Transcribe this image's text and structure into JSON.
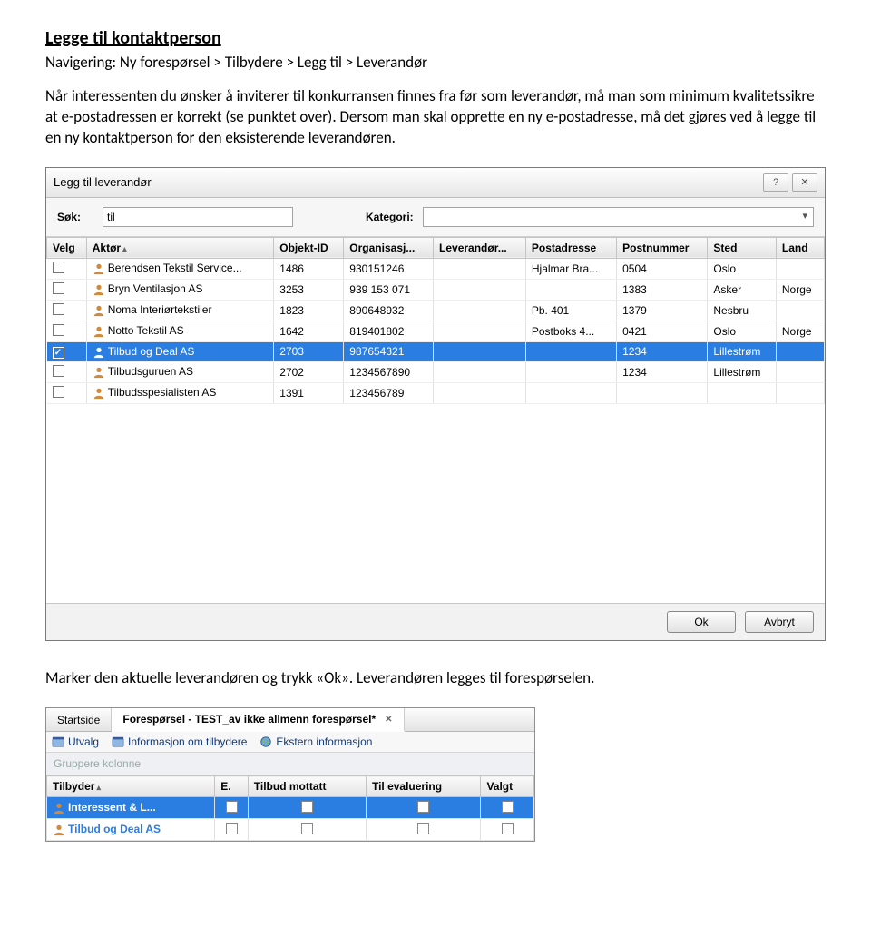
{
  "doc": {
    "heading": "Legge til kontaktperson",
    "nav": "Navigering: Ny forespørsel > Tilbydere > Legg til > Leverandør",
    "body": "Når interessenten du ønsker å inviterer til konkurransen finnes fra før som leverandør, må man som minimum kvalitetssikre at e-postadressen er korrekt (se punktet over). Dersom man skal opprette en ny e-postadresse, må det gjøres ved å legge til en ny kontaktperson for den eksisterende leverandøren.",
    "between": "Marker den aktuelle leverandøren og trykk «Ok». Leverandøren legges til forespørselen."
  },
  "dialog": {
    "title": "Legg til leverandør",
    "search_label": "Søk:",
    "search_value": "til",
    "cat_label": "Kategori:",
    "ok_label": "Ok",
    "cancel_label": "Avbryt",
    "columns": [
      "Velg",
      "Aktør",
      "Objekt-ID",
      "Organisasj...",
      "Leverandør...",
      "Postadresse",
      "Postnummer",
      "Sted",
      "Land"
    ],
    "rows": [
      {
        "checked": false,
        "aktor": "Berendsen Tekstil Service...",
        "id": "1486",
        "org": "930151246",
        "lev": "",
        "post": "Hjalmar Bra...",
        "pnr": "0504",
        "sted": "Oslo",
        "land": ""
      },
      {
        "checked": false,
        "aktor": "Bryn Ventilasjon AS",
        "id": "3253",
        "org": "939 153 071",
        "lev": "",
        "post": "",
        "pnr": "1383",
        "sted": "Asker",
        "land": "Norge"
      },
      {
        "checked": false,
        "aktor": "Noma Interiørtekstiler",
        "id": "1823",
        "org": "890648932",
        "lev": "",
        "post": "Pb. 401",
        "pnr": "1379",
        "sted": "Nesbru",
        "land": ""
      },
      {
        "checked": false,
        "aktor": "Notto Tekstil AS",
        "id": "1642",
        "org": "819401802",
        "lev": "",
        "post": "Postboks 4...",
        "pnr": "0421",
        "sted": "Oslo",
        "land": "Norge"
      },
      {
        "checked": true,
        "selected": true,
        "aktor": "Tilbud og Deal AS",
        "id": "2703",
        "org": "987654321",
        "lev": "",
        "post": "",
        "pnr": "1234",
        "sted": "Lillestrøm",
        "land": ""
      },
      {
        "checked": false,
        "aktor": "Tilbudsguruen AS",
        "id": "2702",
        "org": "1234567890",
        "lev": "",
        "post": "",
        "pnr": "1234",
        "sted": "Lillestrøm",
        "land": ""
      },
      {
        "checked": false,
        "aktor": "Tilbudsspesialisten AS",
        "id": "1391",
        "org": "123456789",
        "lev": "",
        "post": "",
        "pnr": "",
        "sted": "",
        "land": ""
      }
    ]
  },
  "panel": {
    "tabs": [
      {
        "label": "Startside",
        "active": false,
        "closable": false
      },
      {
        "label": "Forespørsel - TEST_av ikke allmenn forespørsel*",
        "active": true,
        "closable": true
      }
    ],
    "sub": [
      "Utvalg",
      "Informasjon om tilbydere",
      "Ekstern informasjon"
    ],
    "group_placeholder": "Gruppere kolonne",
    "columns": [
      "Tilbyder",
      "E.",
      "Tilbud mottatt",
      "Til evaluering",
      "Valgt"
    ],
    "rows": [
      {
        "tilbyder": "Interessent & L...",
        "hl": true
      },
      {
        "tilbyder": "Tilbud og Deal AS",
        "hl": false
      }
    ]
  }
}
